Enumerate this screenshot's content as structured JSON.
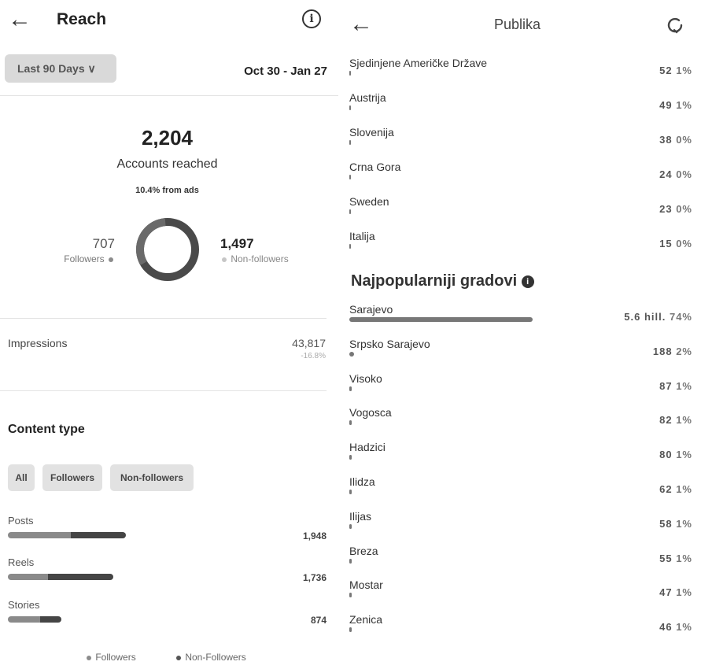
{
  "left": {
    "title": "Reach",
    "back_icon": "←",
    "info_icon": "i",
    "range_button": "Last 90 Days ∨",
    "date_range": "Oct 30 - Jan 27",
    "accounts_reached_value": "2,204",
    "accounts_reached_label": "Accounts reached",
    "from_ads": "10.4% from ads",
    "followers_value": "707",
    "followers_label": "Followers",
    "non_followers_value": "1,497",
    "non_followers_label": "Non-followers",
    "followers_share": 0.32,
    "impressions_label": "Impressions",
    "impressions_value": "43,817",
    "impressions_change": "-16.8%",
    "content_type_title": "Content type",
    "filters": [
      "All",
      "Followers",
      "Non-followers"
    ],
    "content_rows": [
      {
        "label": "Posts",
        "value": "1,948",
        "followers_fraction": 0.53,
        "total_fraction": 1.0
      },
      {
        "label": "Reels",
        "value": "1,736",
        "followers_fraction": 0.38,
        "total_fraction": 0.89
      },
      {
        "label": "Stories",
        "value": "874",
        "followers_fraction": 0.6,
        "total_fraction": 0.45
      }
    ],
    "legend_followers": "Followers",
    "legend_non_followers": "Non-Followers",
    "colors": {
      "followers": "#8a8a8a",
      "non_followers": "#454545",
      "ring": "#4a4a4a"
    }
  },
  "right": {
    "title": "Publika",
    "back_icon": "←",
    "refresh_icon": "refresh",
    "countries": [
      {
        "name": "Sjedinjene Američke Države",
        "count": "52",
        "pct": "1%"
      },
      {
        "name": "Austrija",
        "count": "49",
        "pct": "1%"
      },
      {
        "name": "Slovenija",
        "count": "38",
        "pct": "0%"
      },
      {
        "name": "Crna Gora",
        "count": "24",
        "pct": "0%"
      },
      {
        "name": "Sweden",
        "count": "23",
        "pct": "0%"
      },
      {
        "name": "Italija",
        "count": "15",
        "pct": "0%"
      }
    ],
    "cities_title": "Najpopularniji gradovi",
    "cities": [
      {
        "name": "Sarajevo",
        "count": "5.6 hill.",
        "pct": "74%",
        "share": 0.74
      },
      {
        "name": "Srpsko Sarajevo",
        "count": "188",
        "pct": "2%",
        "share": 0.02
      },
      {
        "name": "Visoko",
        "count": "87",
        "pct": "1%",
        "share": 0.01
      },
      {
        "name": "Vogosca",
        "count": "82",
        "pct": "1%",
        "share": 0.01
      },
      {
        "name": "Hadzici",
        "count": "80",
        "pct": "1%",
        "share": 0.01
      },
      {
        "name": "Ilidza",
        "count": "62",
        "pct": "1%",
        "share": 0.01
      },
      {
        "name": "Ilijas",
        "count": "58",
        "pct": "1%",
        "share": 0.01
      },
      {
        "name": "Breza",
        "count": "55",
        "pct": "1%",
        "share": 0.01
      },
      {
        "name": "Mostar",
        "count": "47",
        "pct": "1%",
        "share": 0.01
      },
      {
        "name": "Zenica",
        "count": "46",
        "pct": "1%",
        "share": 0.01
      }
    ]
  }
}
